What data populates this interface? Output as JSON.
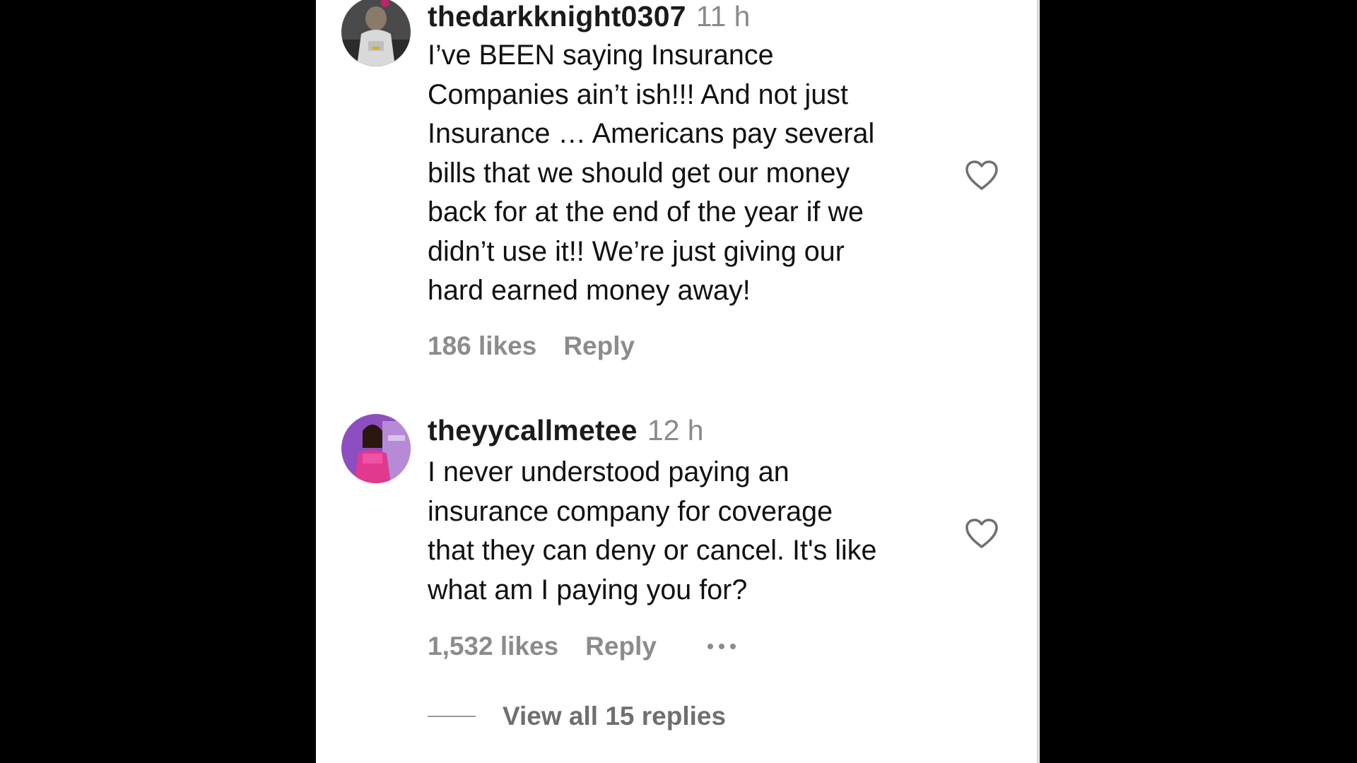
{
  "colors": {
    "background": "#000000",
    "panel": "#ffffff",
    "username": "#1b1b1b",
    "timestamp": "#8a8a8a",
    "meta": "#8c8c8c"
  },
  "comments": [
    {
      "username": "thedarkknight0307",
      "timestamp": "11 h",
      "body_lines": [
        "I’ve BEEN saying Insurance",
        "Companies ain’t ish!!! And not just",
        "Insurance … Americans pay several",
        "bills that we should get our money",
        "back for at the end of the year if we",
        "didn’t use it!! We’re just giving our",
        "hard earned money away!"
      ],
      "likes": "186 likes",
      "reply_label": "Reply",
      "avatar_icon": "user-avatar-icon",
      "like_icon": "heart-outline-icon"
    },
    {
      "username": "theyycallmetee",
      "timestamp": "12 h",
      "body_lines": [
        "I never understood paying an",
        "insurance company for coverage",
        "that they can deny or cancel. It's like",
        "what am I paying you for?"
      ],
      "likes": "1,532 likes",
      "reply_label": "Reply",
      "avatar_icon": "user-avatar-icon",
      "like_icon": "heart-outline-icon",
      "more_icon": "more-options-icon"
    }
  ],
  "view_replies": "View all 15 replies"
}
